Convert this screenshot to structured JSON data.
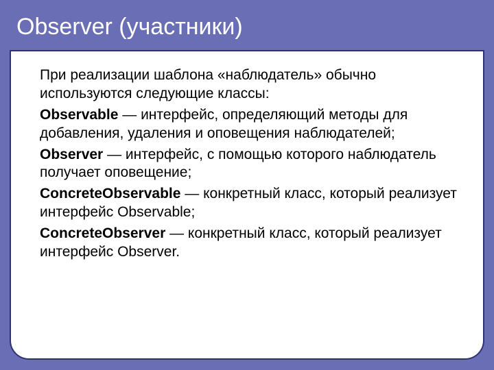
{
  "title": "Observer (участники)",
  "intro": "При реализации шаблона «наблюдатель» обычно используются следующие классы:",
  "items": [
    {
      "term": "Observable",
      "desc": " — интерфейс, определяющий методы для добавления, удаления и оповещения наблюдателей;"
    },
    {
      "term": "Observer",
      "desc": " — интерфейс, с помощью которого наблюдатель получает оповещение;"
    },
    {
      "term": "ConcreteObservable",
      "desc": " — конкретный класс, который реализует интерфейс Observable;"
    },
    {
      "term": "ConcreteObserver",
      "desc": " — конкретный класс, который реализует интерфейс Observer."
    }
  ]
}
